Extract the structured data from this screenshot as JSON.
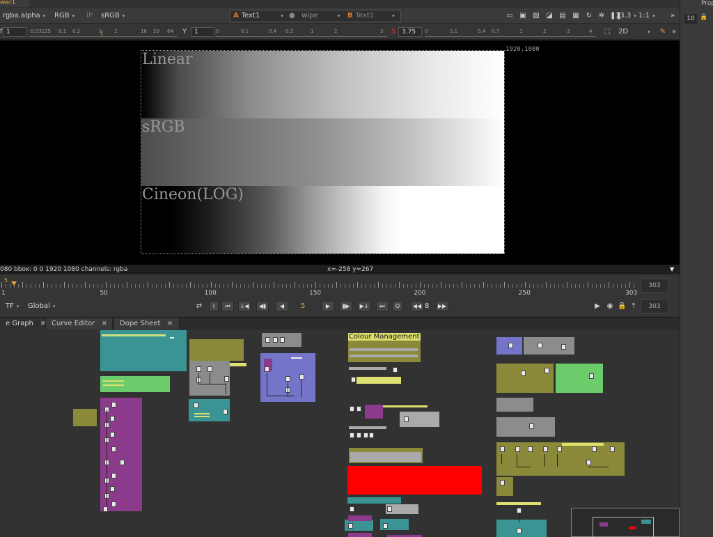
{
  "viewer_tab": "wer1",
  "right_panel": {
    "label": "Prop",
    "count": "10"
  },
  "toolbar": {
    "channel": "rgba.alpha",
    "colorspace": "RGB",
    "ip_label": "IP",
    "lut": "sRGB",
    "a_label": "A",
    "a_input": "Text1",
    "wipe_mode": "wipe",
    "b_label": "B",
    "b_input": "Text1",
    "zoom": "33.3",
    "ratio": "1:1"
  },
  "toolbar2": {
    "f_label": "f",
    "gain": "1",
    "y_label": "Y",
    "gamma": "1",
    "s_label": "S",
    "saturation": "3.75",
    "view_mode": "2D",
    "gain_ticks": [
      "0.03125",
      "0.1",
      "0.2",
      "1",
      "2",
      "16",
      "20",
      "64"
    ],
    "gamma_ticks": [
      "0",
      "0.1",
      "0.4",
      "0.3",
      "1",
      "2",
      "3"
    ],
    "sat_ticks": [
      "0",
      "0.1",
      "0.4",
      "0.7",
      "1",
      "2",
      "3",
      "4"
    ]
  },
  "viewer": {
    "resolution_label": "1920,1080",
    "bands": [
      {
        "label": "Linear"
      },
      {
        "label": "sRGB"
      },
      {
        "label": "Cineon(LOG)"
      }
    ]
  },
  "infobar": {
    "left": "080  bbox: 0 0 1920 1080 channels: rgba",
    "coords": "x=-258 y=267"
  },
  "timeline": {
    "current_frame": "5",
    "ticks": [
      "1",
      "50",
      "100",
      "150",
      "200",
      "250",
      "303"
    ],
    "end_frame": "303",
    "end_frame2": "303",
    "tf_label": "TF",
    "scope": "Global",
    "frame_field": "5",
    "step": "8"
  },
  "tabs": [
    {
      "label": "e Graph"
    },
    {
      "label": "Curve Editor"
    },
    {
      "label": "Dope Sheet"
    }
  ],
  "nodegraph": {
    "colour_management_label": "Colour Management"
  },
  "colors": {
    "teal": "#3a9494",
    "olive": "#8a8a3a",
    "purple": "#8c3a8c",
    "lavender": "#7474c8",
    "green": "#6ccc6c",
    "red": "#ff0000",
    "grey": "#8c8c8c"
  }
}
